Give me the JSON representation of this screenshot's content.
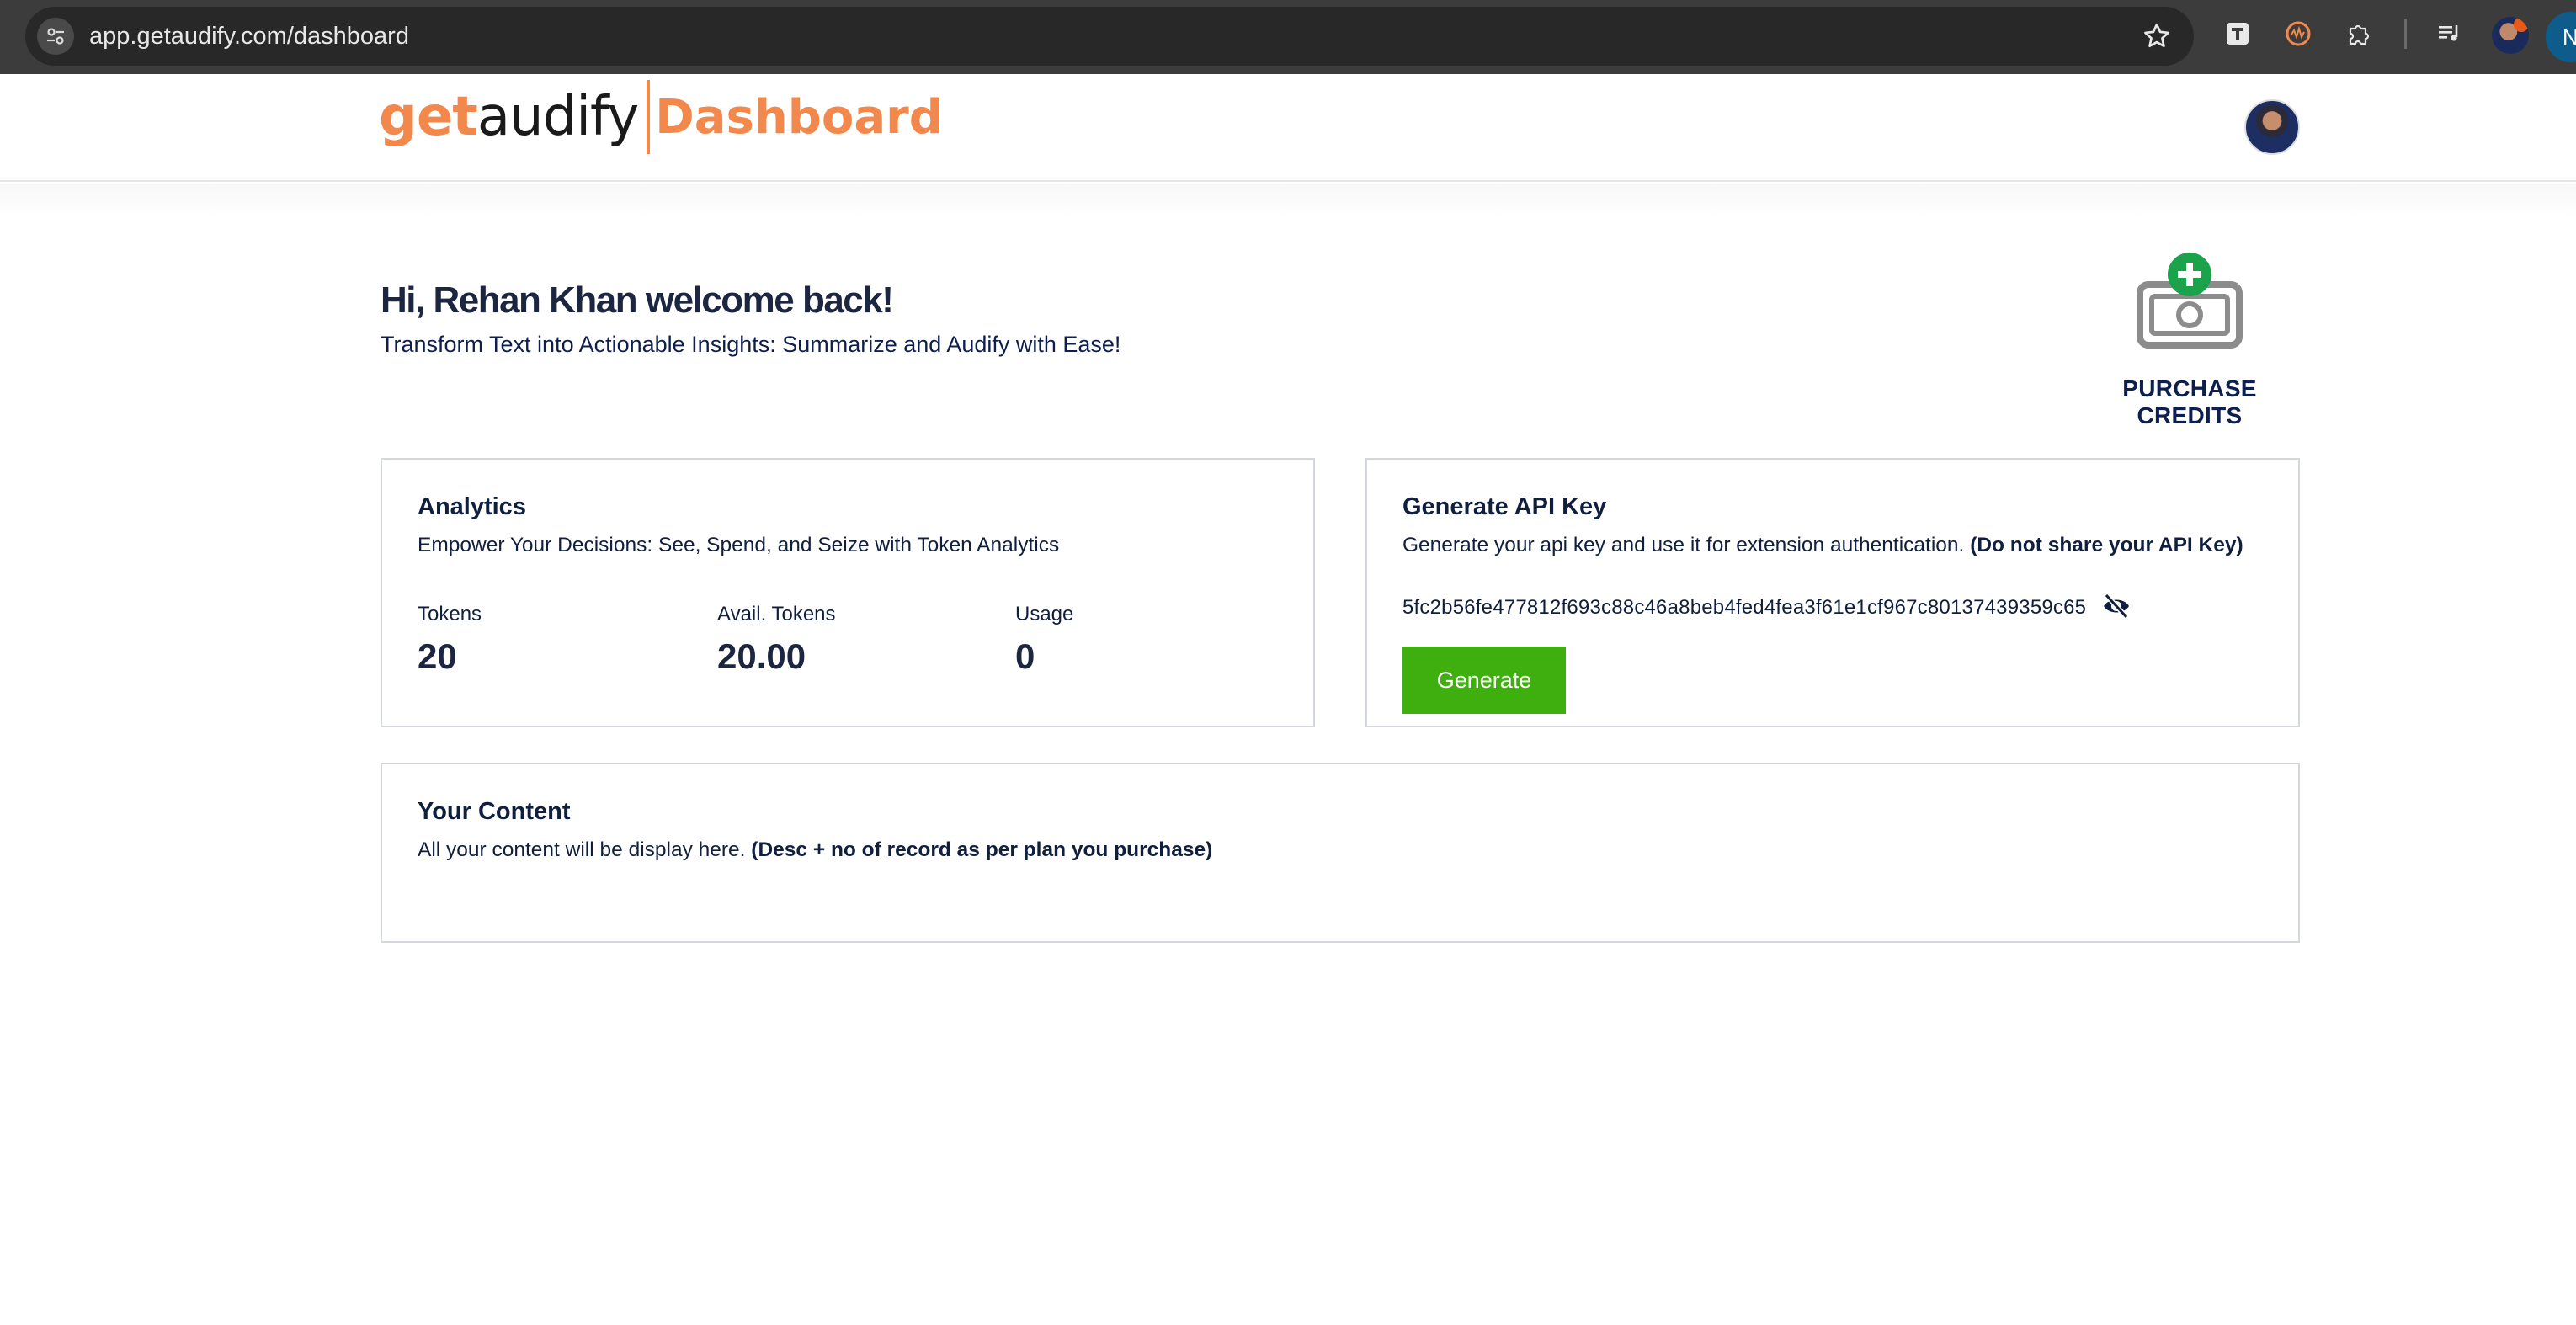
{
  "browser": {
    "url": "app.getaudify.com/dashboard",
    "profile_initial": "N"
  },
  "header": {
    "logo_get": "get",
    "logo_audify": "audify",
    "logo_section": "Dashboard"
  },
  "welcome": {
    "greeting": "Hi, Rehan Khan welcome back!",
    "tagline": "Transform Text into Actionable Insights: Summarize and Audify with Ease!"
  },
  "purchase": {
    "label": "PURCHASE CREDITS"
  },
  "analytics": {
    "title": "Analytics",
    "subtitle": "Empower Your Decisions: See, Spend, and Seize with Token Analytics",
    "stats": [
      {
        "label": "Tokens",
        "value": "20"
      },
      {
        "label": "Avail. Tokens",
        "value": "20.00"
      },
      {
        "label": "Usage",
        "value": "0"
      }
    ]
  },
  "api": {
    "title": "Generate API Key",
    "subtitle": "Generate your api key and use it for extension authentication.",
    "warning": "(Do not share your API Key)",
    "key": "5fc2b56fe477812f693c88c46a8beb4fed4fea3f61e1cf967c80137439359c65",
    "generate_label": "Generate"
  },
  "content": {
    "title": "Your Content",
    "subtitle": "All your content will be display here.",
    "note": "(Desc + no of record as per plan you purchase)"
  },
  "colors": {
    "brand_orange": "#f2884b",
    "navy": "#0f1f3d",
    "generate_green": "#3fae0f",
    "credit_plus_green": "#1aa34a"
  }
}
